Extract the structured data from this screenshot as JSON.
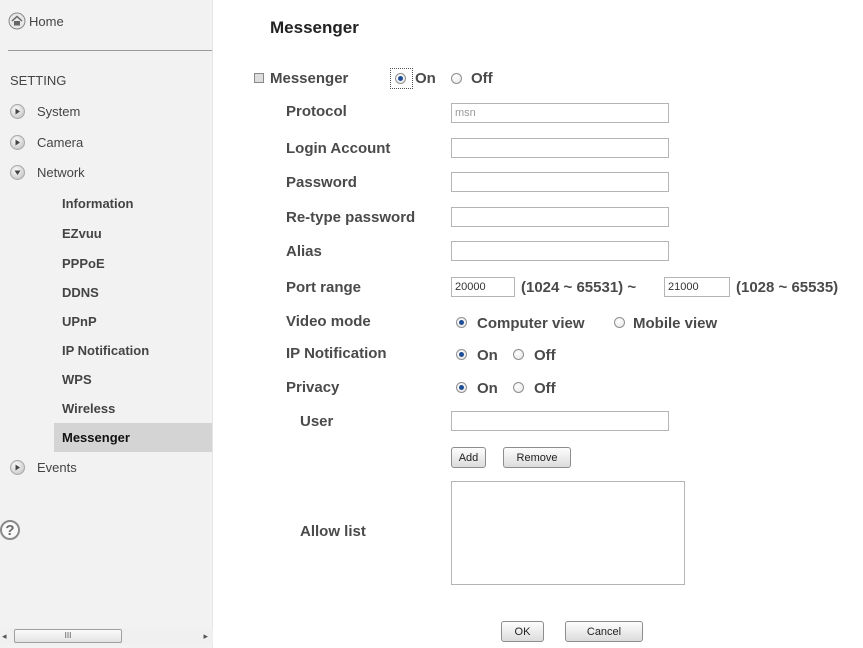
{
  "sidebar": {
    "home_label": "Home",
    "section_heading": "SETTING",
    "items": [
      {
        "label": "System"
      },
      {
        "label": "Camera"
      },
      {
        "label": "Network"
      },
      {
        "label": "Events"
      }
    ],
    "network_sub": [
      {
        "label": "Information"
      },
      {
        "label": "EZvuu"
      },
      {
        "label": "PPPoE"
      },
      {
        "label": "DDNS"
      },
      {
        "label": "UPnP"
      },
      {
        "label": "IP Notification"
      },
      {
        "label": "WPS"
      },
      {
        "label": "Wireless"
      },
      {
        "label": "Messenger"
      }
    ],
    "active_item": "Messenger",
    "help_glyph": "?",
    "scroll_grip": "III"
  },
  "page": {
    "title": "Messenger",
    "messenger_label": "Messenger",
    "on_label": "On",
    "off_label": "Off",
    "protocol_label": "Protocol",
    "protocol_value": "msn",
    "login_label": "Login Account",
    "login_value": "",
    "password_label": "Password",
    "retype_label": "Re-type password",
    "alias_label": "Alias",
    "port_range_label": "Port range",
    "port_start": "20000",
    "port_start_range": "(1024 ~ 65531) ~",
    "port_end": "21000",
    "port_end_range": "(1028 ~ 65535)",
    "video_mode_label": "Video mode",
    "computer_view_label": "Computer view",
    "mobile_view_label": "Mobile view",
    "ip_notification_label": "IP Notification",
    "privacy_label": "Privacy",
    "user_label": "User",
    "add_button": "Add",
    "remove_button": "Remove",
    "allow_list_label": "Allow list",
    "ok_button": "OK",
    "cancel_button": "Cancel"
  },
  "state": {
    "messenger_on": true,
    "video_mode": "Computer view",
    "ip_notification_on": true,
    "privacy_on": true
  },
  "colors": {
    "sidebar_bg": "#f2f2f2",
    "active_bg": "#d4d4d4",
    "radio_dot": "#1d4e95"
  }
}
